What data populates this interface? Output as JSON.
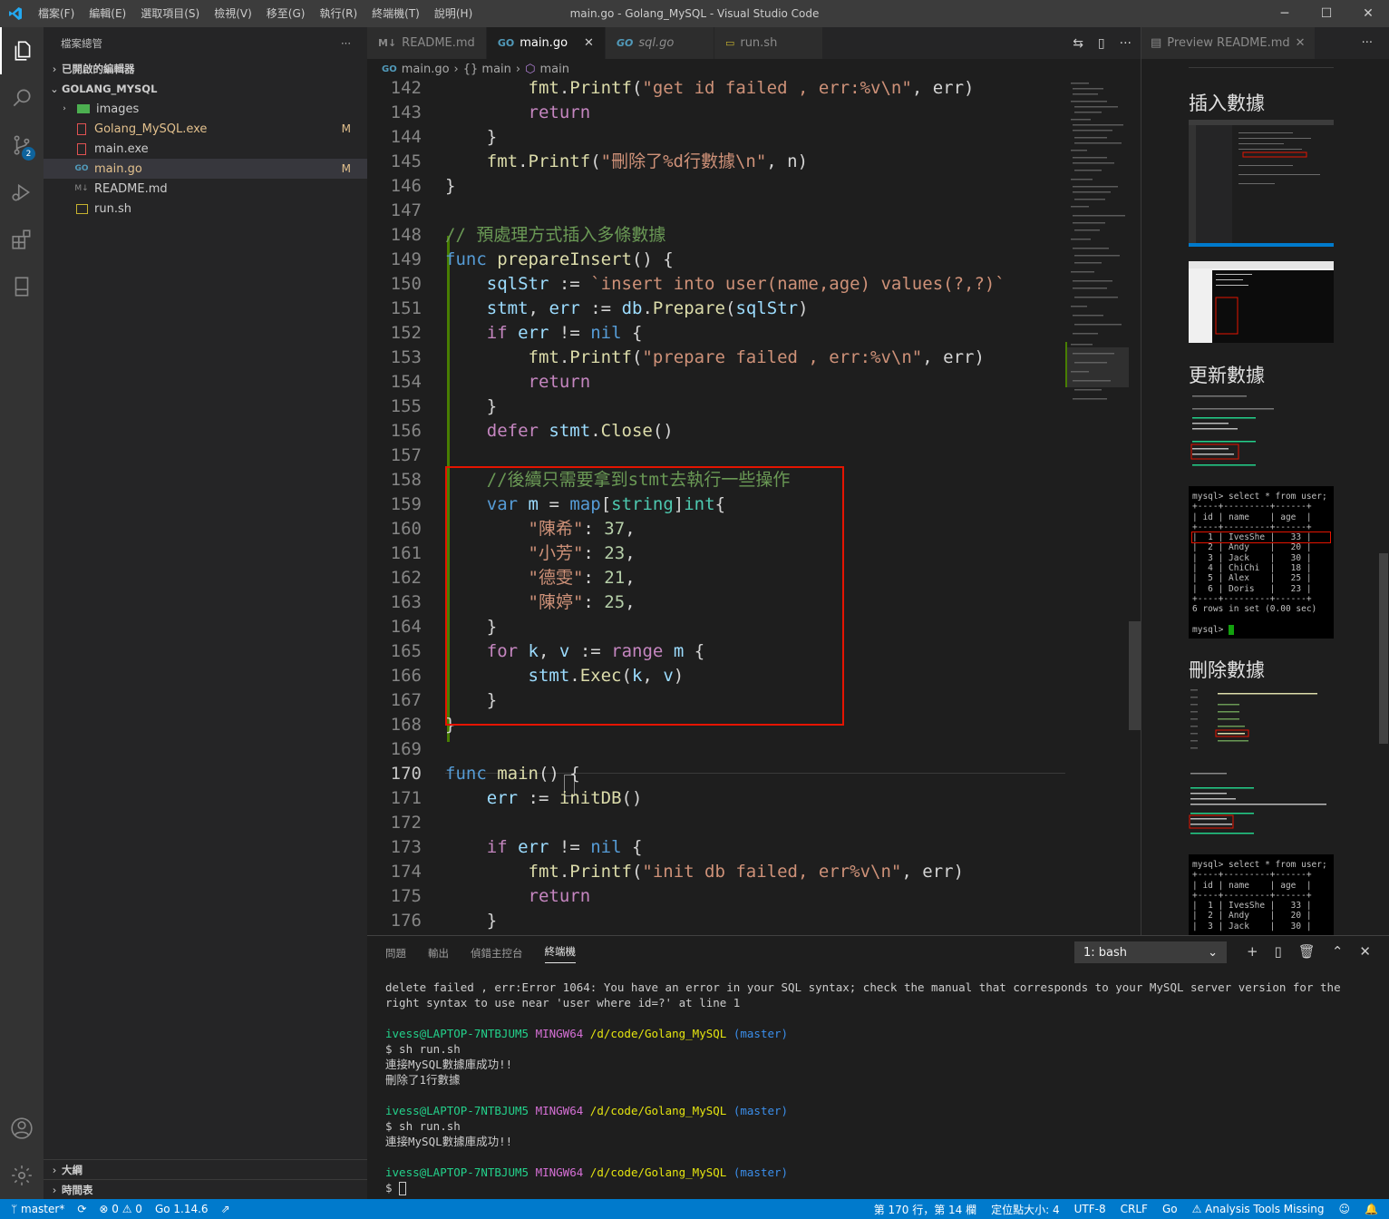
{
  "window": {
    "title": "main.go - Golang_MySQL - Visual Studio Code",
    "menu": [
      "檔案(F)",
      "編輯(E)",
      "選取項目(S)",
      "檢視(V)",
      "移至(G)",
      "執行(R)",
      "終端機(T)",
      "說明(H)"
    ],
    "controls": [
      "─",
      "☐",
      "✕"
    ]
  },
  "activity": {
    "scm_badge": "2"
  },
  "sidebar": {
    "header": "檔案總管",
    "header_more": "···",
    "open_editors": "已開啟的編輯器",
    "folder": "GOLANG_MYSQL",
    "files": [
      {
        "name": "images",
        "mark": ""
      },
      {
        "name": "Golang_MySQL.exe",
        "mark": "M"
      },
      {
        "name": "main.exe",
        "mark": ""
      },
      {
        "name": "main.go",
        "mark": "M"
      },
      {
        "name": "README.md",
        "mark": ""
      },
      {
        "name": "run.sh",
        "mark": ""
      }
    ],
    "outline": "大綱",
    "timeline": "時間表"
  },
  "tabs": [
    {
      "label": "README.md",
      "icon": "M↓"
    },
    {
      "label": "main.go",
      "icon": "GO"
    },
    {
      "label": "sql.go",
      "icon": "GO"
    },
    {
      "label": "run.sh",
      "icon": "▭"
    }
  ],
  "breadcrumb": [
    "main.go",
    "{} main",
    "main"
  ],
  "editor": {
    "line_numbers": [
      "142",
      "143",
      "144",
      "145",
      "146",
      "147",
      "148",
      "149",
      "150",
      "151",
      "152",
      "153",
      "154",
      "155",
      "156",
      "157",
      "158",
      "159",
      "160",
      "161",
      "162",
      "163",
      "164",
      "165",
      "166",
      "167",
      "168",
      "169",
      "170",
      "171",
      "172",
      "173",
      "174",
      "175",
      "176"
    ],
    "strings": {
      "s142": "\"get id failed , err:%v\\n\"",
      "s145": "\"刪除了%d行數據\\n\"",
      "c148": "// 預處理方式插入多條數據",
      "s150": "`insert into user(name,age) values(?,?)`",
      "s153": "\"prepare failed , err:%v\\n\"",
      "c158": "//後續只需要拿到stmt去執行一些操作",
      "k160": "\"陳希\"",
      "n160": "37",
      "k161": "\"小芳\"",
      "n161": "23",
      "k162": "\"德雯\"",
      "n162": "21",
      "k163": "\"陳婷\"",
      "n163": "25",
      "s174": "\"init db failed, err%v\\n\""
    }
  },
  "preview": {
    "tab": "Preview README.md",
    "sections": [
      "插入數據",
      "更新數據",
      "刪除數據"
    ],
    "mysql1": {
      "prompt": "mysql> select * from user;",
      "header": "| id | name    | age  |",
      "rows": [
        "|  1 | IvesShe |   33 |",
        "|  2 | Andy    |   20 |",
        "|  3 | Jack    |   30 |",
        "|  4 | ChiChi  |   18 |",
        "|  5 | Alex    |   25 |",
        "|  6 | Doris   |   23 |"
      ],
      "footer": "6 rows in set (0.00 sec)",
      "end": "mysql>"
    },
    "mysql2": {
      "prompt": "mysql> select * from user;",
      "header": "| id | name    | age  |",
      "rows": [
        "|  1 | IvesShe |   33 |",
        "|  2 | Andy    |   20 |",
        "|  3 | Jack    |   30 |"
      ]
    }
  },
  "panel": {
    "tabs": [
      "問題",
      "輸出",
      "偵錯主控台",
      "終端機"
    ],
    "terminal_select": "1: bash",
    "terminal": {
      "err": "delete failed , err:Error 1064: You have an error in your SQL syntax; check the manual that corresponds to your MySQL server version for the right syntax to use near 'user where id=?' at line 1",
      "user": "ivess@LAPTOP-7NTBJUM5",
      "env": "MINGW64",
      "path": "/d/code/Golang_MySQL",
      "branch": "(master)",
      "cmd": "$ sh run.sh",
      "ok": "連接MySQL數據庫成功!!",
      "deleted": "刪除了1行數據",
      "prompt": "$"
    }
  },
  "status": {
    "branch": "master*",
    "errors": "⊗ 0 ⚠ 0",
    "go": "Go 1.14.6",
    "position": "第 170 行，第 14 欄",
    "tab_size": "定位點大小: 4",
    "encoding": "UTF-8",
    "eol": "CRLF",
    "lang": "Go",
    "analysis": "⚠ Analysis Tools Missing"
  }
}
